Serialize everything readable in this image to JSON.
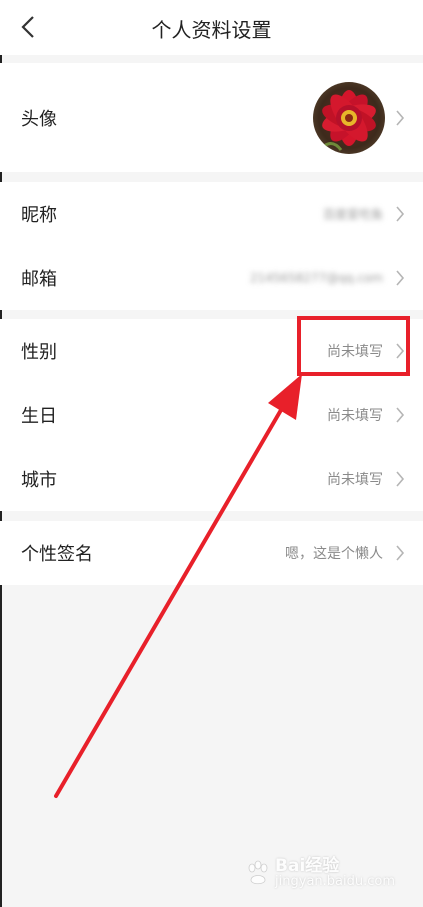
{
  "header": {
    "title": "个人资料设置"
  },
  "rows": {
    "avatar": {
      "label": "头像"
    },
    "nickname": {
      "label": "昵称",
      "value": "百度爱吃鱼"
    },
    "email": {
      "label": "邮箱",
      "value": "2145658277@qq.com"
    },
    "gender": {
      "label": "性别",
      "value": "尚未填写"
    },
    "birthday": {
      "label": "生日",
      "value": "尚未填写"
    },
    "city": {
      "label": "城市",
      "value": "尚未填写"
    },
    "signature": {
      "label": "个性签名",
      "value": "嗯，这是个懒人"
    }
  },
  "watermark": {
    "brand": "Bai",
    "text": "经验",
    "sub": "jingyan.baidu.com"
  },
  "colors": {
    "highlight": "#e8202a",
    "background": "#f5f5f5",
    "value_text": "#8a8a8a"
  }
}
